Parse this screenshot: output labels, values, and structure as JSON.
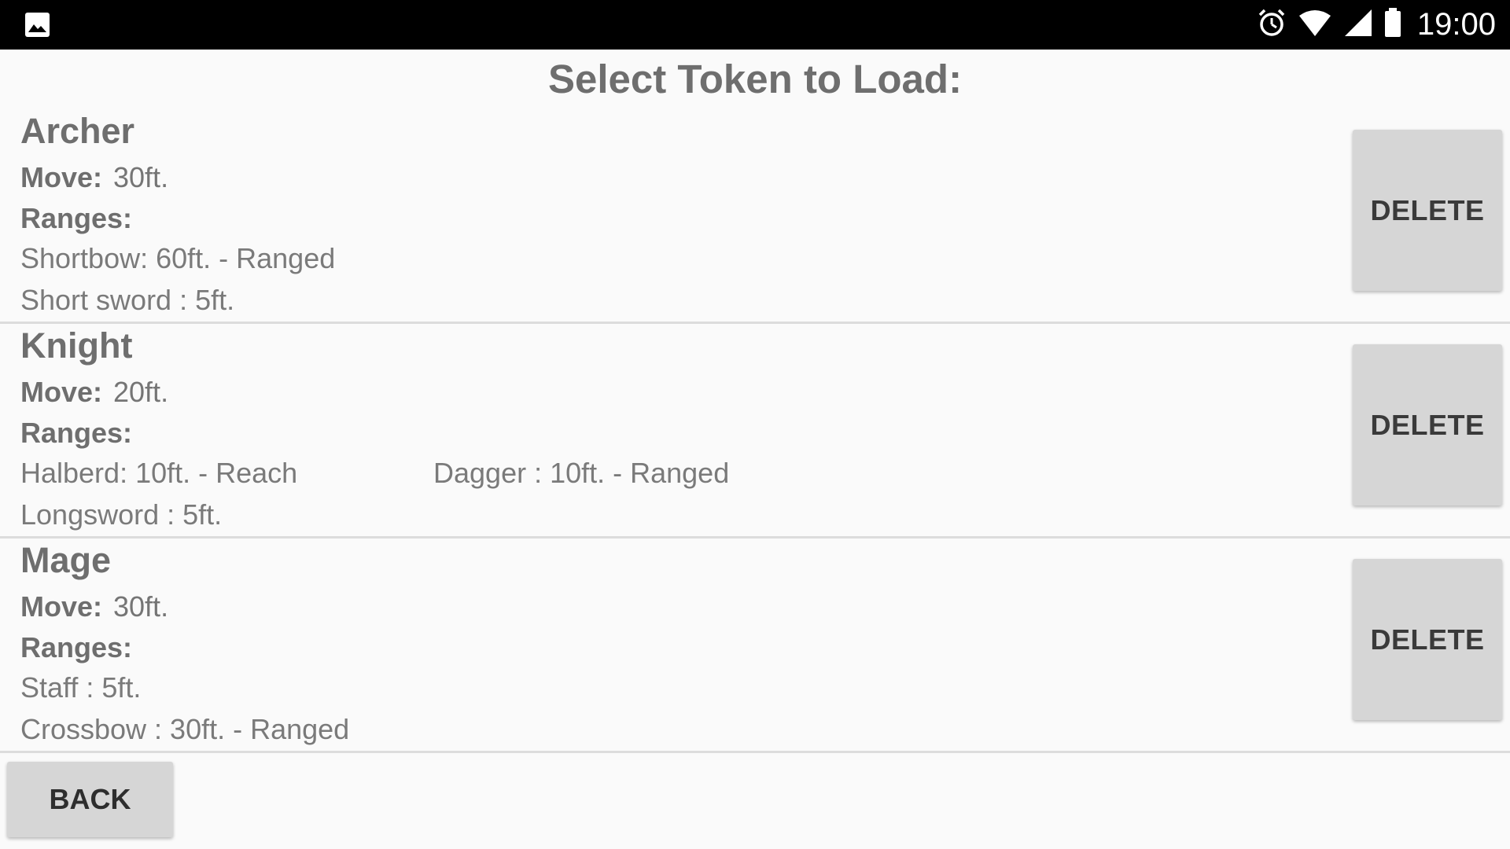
{
  "status_bar": {
    "time": "19:00",
    "icons": [
      "image-icon",
      "alarm-icon",
      "wifi-icon",
      "signal-icon",
      "battery-icon"
    ]
  },
  "header": {
    "title": "Select Token to Load:"
  },
  "tokens": [
    {
      "name": "Archer",
      "move_label": "Move:",
      "move_value": "30ft.",
      "ranges_label": "Ranges:",
      "ranges": [
        "Shortbow: 60ft. - Ranged",
        "Short sword : 5ft."
      ],
      "delete_label": "DELETE"
    },
    {
      "name": "Knight",
      "move_label": "Move:",
      "move_value": "20ft.",
      "ranges_label": "Ranges:",
      "ranges": [
        "Halberd: 10ft. - Reach",
        "Longsword : 5ft.",
        "Dagger : 10ft. - Ranged"
      ],
      "delete_label": "DELETE"
    },
    {
      "name": "Mage",
      "move_label": "Move:",
      "move_value": "30ft.",
      "ranges_label": "Ranges:",
      "ranges": [
        "Staff : 5ft.",
        "Crossbow : 30ft. - Ranged"
      ],
      "delete_label": "DELETE"
    }
  ],
  "footer": {
    "back_label": "BACK"
  },
  "colors": {
    "background": "#fafafa",
    "status_bar": "#000000",
    "button": "#d6d6d6",
    "divider": "#dcdcdc"
  }
}
